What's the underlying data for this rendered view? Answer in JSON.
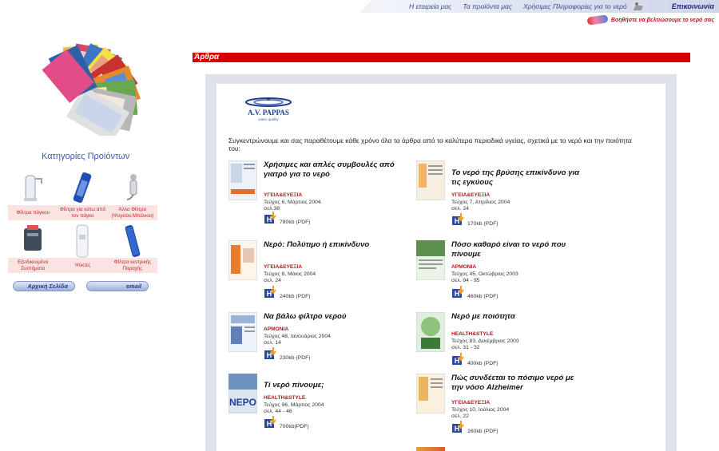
{
  "nav": {
    "items": [
      "Η εταιρεία μας",
      "Τα προϊόντα μας",
      "Χρήσιμες Πληροφορίες για το νερό"
    ],
    "contact": "Επικοινωνία",
    "subtitle": "Βοηθήστε να βελτιώσουμε το νερό σας"
  },
  "sidebar": {
    "categories_title": "Κατηγορίες Προϊόντων",
    "products": [
      {
        "label": "Φίλτρα πάγκου",
        "icon": "faucet-filter-icon"
      },
      {
        "label": "Φίλτρα για κάτω από τον πάγκο",
        "icon": "under-sink-filter-icon"
      },
      {
        "label": "Άλλα Φίλτρα (Ψυγείου,Μπάνιου)",
        "icon": "shower-filter-icon"
      },
      {
        "label": "Εξειδικευμένα Συστήματα",
        "icon": "system-filter-icon"
      },
      {
        "label": "Ψύκτες",
        "icon": "water-cooler-icon"
      },
      {
        "label": "Φίλτρα κεντρικής Παροχής",
        "icon": "central-filter-icon"
      }
    ],
    "home_button": "Αρχική Σελίδα",
    "email_button": "email"
  },
  "section": {
    "title": "Άρθρα"
  },
  "content": {
    "logo_text": "A.V. PAPPAS",
    "logo_sub": "water quality",
    "intro": "Συγκεντρώνουμε και σας παραθέτουμε κάθε χρόνο όλα τα άρθρα από τα καλύτερα περιοδικά υγείας, σχετικά με το νερό και την ποιότητα του:",
    "articles": [
      {
        "title": "Χρήσιμες και απλές συμβουλές από γιατρό για το νερό",
        "source": "ΥΓΕΙΑ&ΕΥΕΞΙΑ",
        "issue": "Τεύχος 6, Μάρτιος 2004",
        "page": "σελ.38",
        "size": "780kb (PDF)"
      },
      {
        "title": "Το νερό της βρύσης επικίνδυνο για τις εγκύους",
        "source": "ΥΓΕΙΑ&ΕΥΕΞΙΑ",
        "issue": "Τεύχος 7, Απρίλιος 2004",
        "page": "σελ. 24",
        "size": "170kb (PDF)"
      },
      {
        "title": "Νερό: Πολύτιμο ή επικίνδυνο",
        "source": "ΥΓΕΙΑ&ΕΥΕΞΙΑ",
        "issue": "Τεύχος 8, Μάιος 2004",
        "page": "σελ. 24",
        "size": "240kb (PDF)"
      },
      {
        "title": "Πόσο καθαρό είναι το νερό που πίνουμε",
        "source": "ΑΡΜΟΝΙΑ",
        "issue": "Τεύχος 45, Οκτώβριος 2003",
        "page": "σελ. 94 - 95",
        "size": "460kb (PDF)"
      },
      {
        "title": "Να βάλω φίλτρο νερού",
        "source": "ΑΡΜΟΝΙΑ",
        "issue": "Τεύχος 48, Ιανουάριος 2004",
        "page": "σελ. 14",
        "size": "230kb (PDF)"
      },
      {
        "title": "Νερό με ποιότητα",
        "source": "HEALTH&STYLE",
        "issue": "Τεύχος 83, Δεκέμβριος 2003",
        "page": "σελ. 31 - 32",
        "size": "400kb (PDF)"
      },
      {
        "title": "Τί νερό πίνουμε;",
        "source": "HEALTH&STYLE",
        "issue": "Τεύχος 96, Μάρτιος 2004",
        "page": "σελ. 44 - 46",
        "size": "700kb(PDF)"
      },
      {
        "title": "Πώς συνδέεται το πόσιμο νερό με την νόσο Alzheimer",
        "source": "ΥΓΕΙΑ&ΕΥΕΞΙΑ",
        "issue": "Τεύχος 10, Ιούλιος 2004",
        "page": "σελ. 22",
        "size": "260kb (PDF)"
      }
    ]
  }
}
